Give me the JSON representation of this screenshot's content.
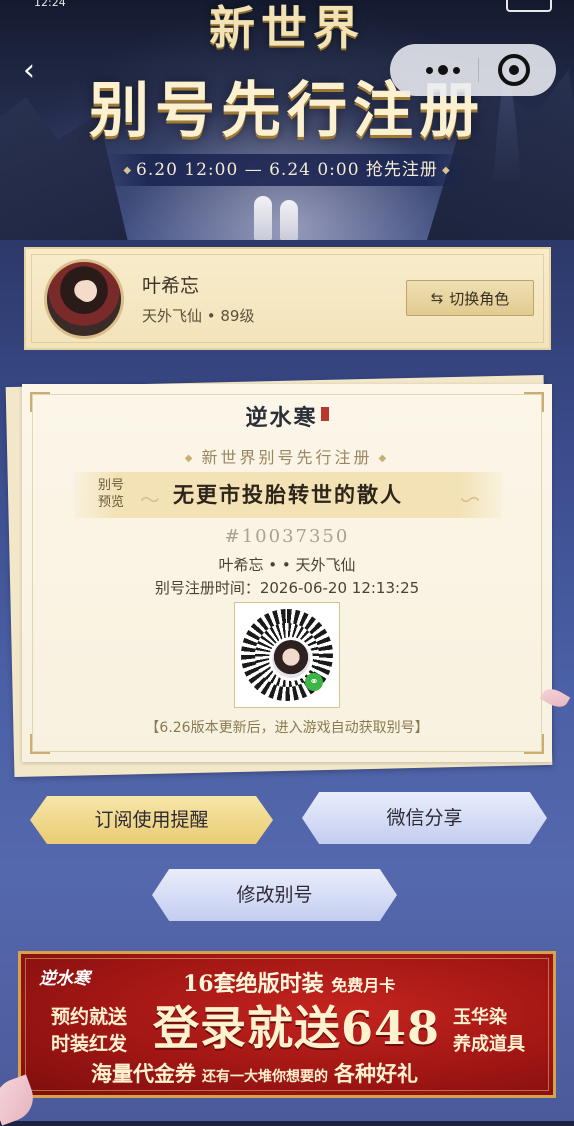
{
  "status_bar": {
    "time": "12:24"
  },
  "header": {
    "title_small": "新世界",
    "title_big": "别号先行注册",
    "date_range": "6.20 12:00 — 6.24 0:00 抢先注册"
  },
  "capsule": {
    "more_icon": "more-dots-icon",
    "close_icon": "target-close-icon"
  },
  "character": {
    "name": "叶希忘",
    "meta": "天外飞仙 • 89级",
    "switch_label": "切换角色"
  },
  "certificate": {
    "logo": "逆水寒",
    "subtitle": "新世界别号先行注册",
    "preview_label": "别号预览",
    "preview_name": "无更市投胎转世的散人",
    "number": "#10037350",
    "owner": "叶希忘 • • 天外飞仙",
    "time": "别号注册时间：2026-06-20 12:13:25",
    "note": "【6.26版本更新后，进入游戏自动获取别号】"
  },
  "actions": {
    "subscribe": "订阅使用提醒",
    "share": "微信分享",
    "modify": "修改别号"
  },
  "ad": {
    "logo": "逆水寒",
    "line1_main": "16套绝版时装",
    "line1_small": "免费月卡",
    "left_1": "预约就送",
    "left_2": "时装红发",
    "big": "登录就送648",
    "right_1": "玉华染",
    "right_2": "养成道具",
    "bottom_main": "海量代金券",
    "bottom_small": "还有一大堆你想要的",
    "bottom_end": "各种好礼"
  }
}
